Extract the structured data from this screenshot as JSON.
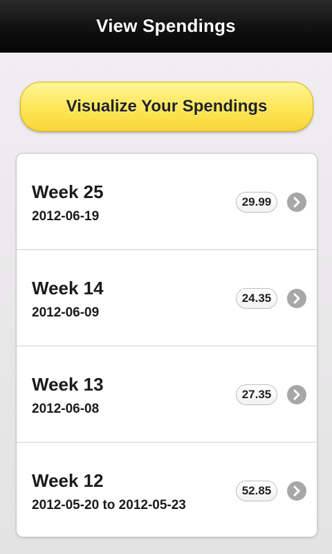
{
  "header": {
    "title": "View Spendings"
  },
  "visualize_button": {
    "label": "Visualize Your Spendings"
  },
  "weeks": [
    {
      "title": "Week 25",
      "date": "2012-06-19",
      "amount": "29.99",
      "icon": "chevron-right-icon"
    },
    {
      "title": "Week 14",
      "date": "2012-06-09",
      "amount": "24.35",
      "icon": "chevron-right-icon"
    },
    {
      "title": "Week 13",
      "date": "2012-06-08",
      "amount": "27.35",
      "icon": "chevron-right-icon"
    },
    {
      "title": "Week 12",
      "date": "2012-05-20 to 2012-05-23",
      "amount": "52.85",
      "icon": "chevron-right-icon"
    }
  ],
  "colors": {
    "header_bg": "#111111",
    "button_yellow": "#fde75a",
    "chevron_gray": "#a7a7a7"
  }
}
